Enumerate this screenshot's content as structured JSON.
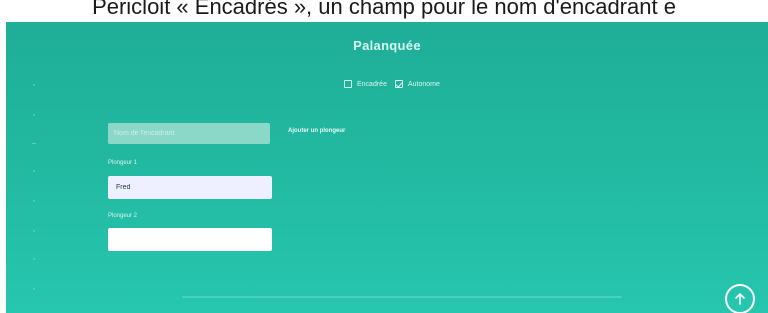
{
  "caption": "Pericloit « Encadrés », un champ pour le nom d'encadrant e",
  "app": {
    "title": "Palanquée"
  },
  "options": [
    {
      "label": "Encadrée",
      "checked": false
    },
    {
      "label": "Autonome",
      "checked": true
    }
  ],
  "guide": {
    "placeholder": "Nom de l'encadrant"
  },
  "add_diver_label": "Ajouter un plongeur",
  "fields": [
    {
      "label": "Plongeur 1",
      "value": "Fred"
    },
    {
      "label": "Plongeur 2",
      "value": ""
    }
  ],
  "fab": {
    "icon": "arrow-up-icon"
  },
  "colors": {
    "accent": "#22b8a0",
    "text": "#d7f7f1"
  }
}
